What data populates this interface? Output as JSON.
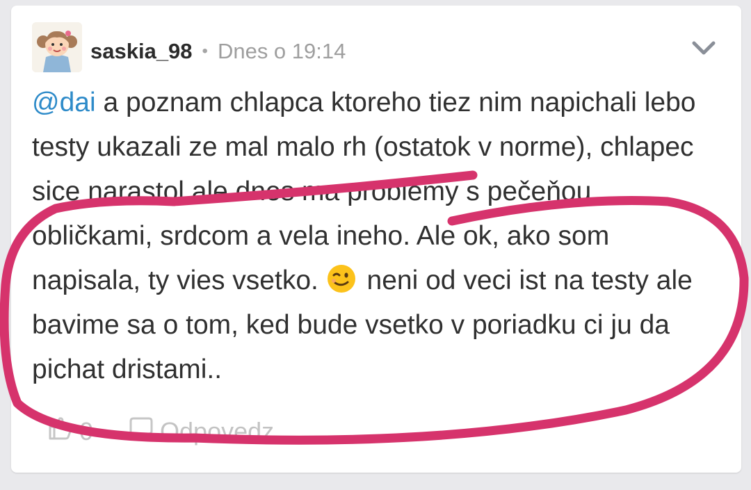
{
  "post": {
    "author": "saskia_98",
    "separator": "•",
    "timestamp": "Dnes o 19:14",
    "mention": "@dai",
    "text_part1": " a poznam chlapca ktoreho tiez nim napichali lebo testy ukazali ze mal malo rh (ostatok v norme), chlapec sice narastol ale dnes ma problemy s pečeňou, obličkami, srdcom a vela ineho. Ale ok, ako som napisala, ty vies vsetko. ",
    "emoji": "wink-emoji",
    "text_part2": " neni od veci ist na testy ale bavime sa o tom, ked bude vsetko v poriadku ci ju da pichat dristami.."
  },
  "footer": {
    "like_count": "0",
    "reply_label": "Odpovedz"
  },
  "icons": {
    "menu": "chevron-down-icon",
    "like": "thumbs-up-icon",
    "reply": "speech-bubble-icon"
  },
  "colors": {
    "mention": "#2e8bc9",
    "annotation": "#d6336c",
    "background": "#e9e9ec"
  }
}
